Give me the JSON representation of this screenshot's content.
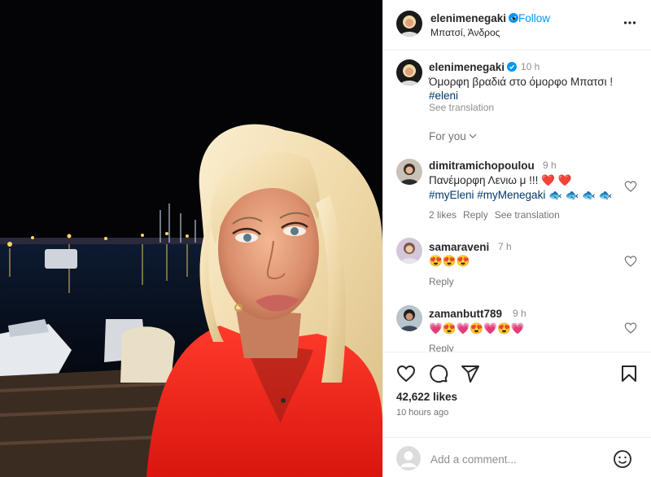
{
  "header": {
    "username": "elenimenegaki",
    "separator": "•",
    "follow_label": "Follow",
    "location": "Μπατσί, Άνδρος"
  },
  "caption": {
    "username": "elenimenegaki",
    "time": "10 h",
    "text": "Όμορφη βραδιά στο όμορφο Μπατσι !",
    "hashtag": "#eleni",
    "see_translation": "See translation"
  },
  "for_you_label": "For you",
  "comments": [
    {
      "username": "dimitramichopoulou",
      "time": "9 h",
      "text": "Πανέμορφη Λενιω μ !!! ❤️ ❤️",
      "tags": "#myEleni #myMenegaki 🐟 🐟 🐟 🐟",
      "likes": "2 likes",
      "reply": "Reply",
      "see_translation": "See translation"
    },
    {
      "username": "samaraveni",
      "time": "7 h",
      "text": "😍😍😍",
      "reply": "Reply"
    },
    {
      "username": "zamanbutt789",
      "time": "9 h",
      "text": "💗😍💗😍💗😍💗",
      "reply": "Reply"
    }
  ],
  "likes_count": "42,622 likes",
  "posted_ago": "10 hours ago",
  "comment_input": {
    "placeholder": "Add a comment..."
  },
  "colors": {
    "link_blue": "#0095f6",
    "hashtag_blue": "#00376b",
    "verified_blue": "#0095f6",
    "heart_red": "#ed4956"
  },
  "icons": [
    "verified-badge-icon",
    "more-options-icon",
    "chevron-down-icon",
    "heart-outline-icon",
    "comment-icon",
    "share-icon",
    "bookmark-icon",
    "emoji-icon"
  ]
}
